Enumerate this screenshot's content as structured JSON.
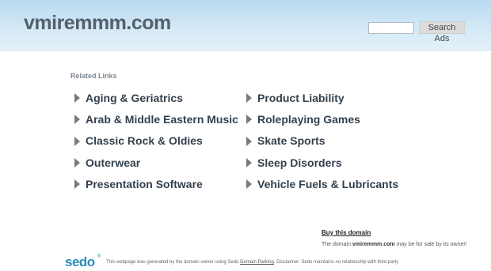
{
  "header": {
    "domain_title": "vmiremmm.com",
    "search_placeholder": "",
    "search_button": "Search Ads"
  },
  "related": {
    "heading": "Related Links",
    "left": [
      "Aging & Geriatrics",
      "Arab & Middle Eastern Music",
      "Classic Rock & Oldies",
      "Outerwear",
      "Presentation Software"
    ],
    "right": [
      "Product Liability",
      "Roleplaying Games",
      "Skate Sports",
      "Sleep Disorders",
      "Vehicle Fuels & Lubricants"
    ]
  },
  "sale": {
    "buy_link": "Buy this domain",
    "prefix": "The domain",
    "domain": "vmiremmm.com",
    "suffix": "may be for sale by its owner!"
  },
  "footer": {
    "logo": "sedo",
    "logo_mark": "®",
    "text_a": "This webpage was generated by the domain owner using Sedo",
    "parking_link": "Domain Parking",
    "text_b": ". Disclaimer: Sedo maintains no relationship with third party"
  },
  "colors": {
    "header_bg": "#c8e2f3",
    "link_text": "#34414d",
    "sedo_blue": "#2b8bbf"
  }
}
